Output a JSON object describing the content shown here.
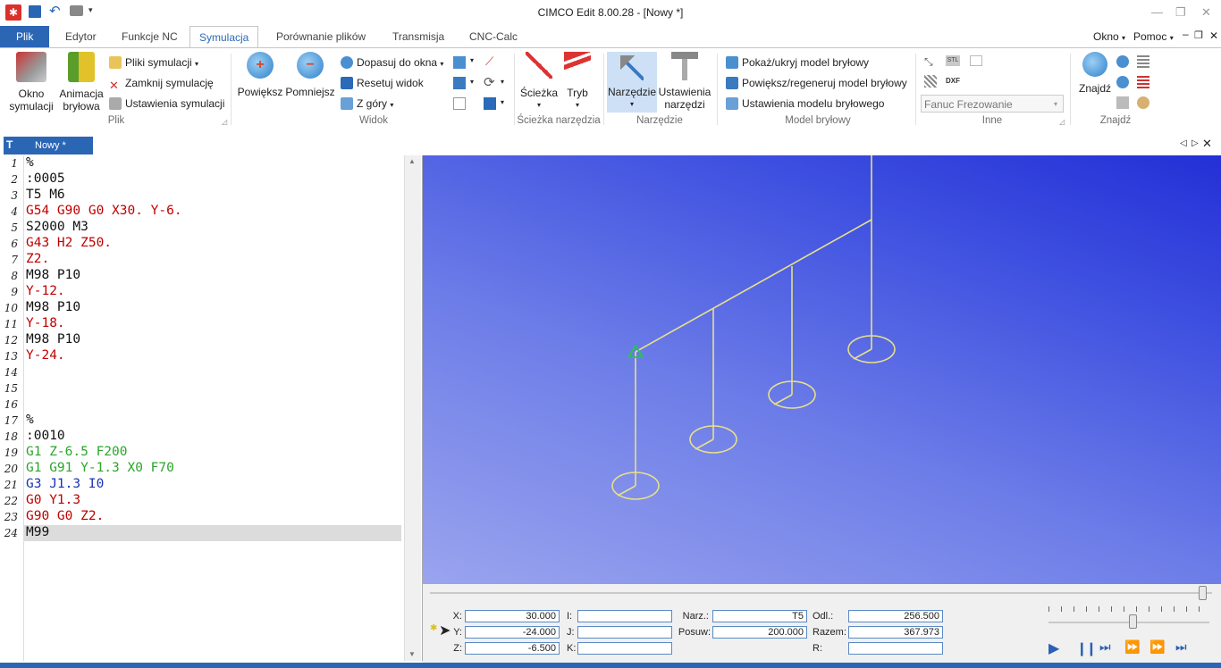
{
  "window": {
    "title": "CIMCO Edit 8.00.28 - [Nowy *]"
  },
  "menu": {
    "tabs": [
      "Plik",
      "Edytor",
      "Funkcje NC",
      "Symulacja",
      "Porównanie plików",
      "Transmisja",
      "CNC-Calc"
    ],
    "right": {
      "okno": "Okno",
      "pomoc": "Pomoc"
    }
  },
  "ribbon": {
    "plik": {
      "okno_symulacji": [
        "Okno",
        "symulacji"
      ],
      "animacja": [
        "Animacja",
        "bryłowa"
      ],
      "pliki_symulacji": "Pliki symulacji",
      "zamknij_symulacje": "Zamknij symulację",
      "ustawienia_symulacji": "Ustawienia symulacji",
      "label": "Plik"
    },
    "widok": {
      "powieksz": "Powiększ",
      "pomniejsz": "Pomniejsz",
      "dopasuj": "Dopasuj do okna",
      "resetuj": "Resetuj widok",
      "z_gory": "Z góry",
      "label": "Widok"
    },
    "sciezka": {
      "sciezka": "Ścieżka",
      "tryb": "Tryb",
      "label": "Ścieżka narzędzia"
    },
    "narzedzie": {
      "narzedzie": "Narzędzie",
      "ustawienia": [
        "Ustawienia",
        "narzędzi"
      ],
      "label": "Narzędzie"
    },
    "model": {
      "pokaz": "Pokaż/ukryj model bryłowy",
      "powieksz": "Powiększ/regeneruj model bryłowy",
      "ustawienia": "Ustawienia modelu bryłowego",
      "label": "Model bryłowy"
    },
    "inne": {
      "dxf": "DXF",
      "stl": "STL",
      "machine_select": "Fanuc Frezowanie",
      "label": "Inne"
    },
    "znajdz": {
      "znajdz": "Znajdź",
      "label": "Znajdź"
    }
  },
  "document": {
    "tab": "Nowy *"
  },
  "editor": {
    "lines": [
      {
        "n": "1",
        "text": "%",
        "color": "#111"
      },
      {
        "n": "2",
        "text": ":0005",
        "color": "#111"
      },
      {
        "n": "3",
        "text": "T5 M6",
        "color": "#111"
      },
      {
        "n": "4",
        "text": "G54 G90 G0 X30. Y-6.",
        "color": "#c00000"
      },
      {
        "n": "5",
        "text": "S2000 M3",
        "color": "#111"
      },
      {
        "n": "6",
        "text": "G43 H2 Z50.",
        "color": "#c00000"
      },
      {
        "n": "7",
        "text": "Z2.",
        "color": "#c00000"
      },
      {
        "n": "8",
        "text": "M98 P10",
        "color": "#111"
      },
      {
        "n": "9",
        "text": "Y-12.",
        "color": "#c00000"
      },
      {
        "n": "10",
        "text": "M98 P10",
        "color": "#111"
      },
      {
        "n": "11",
        "text": "Y-18.",
        "color": "#c00000"
      },
      {
        "n": "12",
        "text": "M98 P10",
        "color": "#111"
      },
      {
        "n": "13",
        "text": "Y-24.",
        "color": "#c00000"
      },
      {
        "n": "14",
        "text": "",
        "color": "#111"
      },
      {
        "n": "15",
        "text": "",
        "color": "#111"
      },
      {
        "n": "16",
        "text": "",
        "color": "#111"
      },
      {
        "n": "17",
        "text": "%",
        "color": "#111"
      },
      {
        "n": "18",
        "text": ":0010",
        "color": "#111"
      },
      {
        "n": "19",
        "text": "G1 Z-6.5 F200",
        "color": "#2aa52a"
      },
      {
        "n": "20",
        "text": "G1 G91 Y-1.3 X0 F70",
        "color": "#2aa52a"
      },
      {
        "n": "21",
        "text": "G3 J1.3 I0",
        "color": "#1a32b8"
      },
      {
        "n": "22",
        "text": "G0 Y1.3",
        "color": "#c00000"
      },
      {
        "n": "23",
        "text": "G90 G0 Z2.",
        "color": "#c00000"
      },
      {
        "n": "24",
        "text": "M99",
        "color": "#111"
      }
    ],
    "current_line": 24
  },
  "simulation": {
    "fields": {
      "x_label": "X:",
      "x": "30.000",
      "y_label": "Y:",
      "y": "-24.000",
      "z_label": "Z:",
      "z": "-6.500",
      "i_label": "I:",
      "i": "",
      "j_label": "J:",
      "j": "",
      "k_label": "K:",
      "k": "",
      "narz_label": "Narz.:",
      "narz": "T5",
      "posuw_label": "Posuw:",
      "posuw": "200.000",
      "odl_label": "Odl.:",
      "odl": "256.500",
      "razem_label": "Razem:",
      "razem": "367.973",
      "r_label": "R:",
      "r": ""
    },
    "timeline_progress": 0.987,
    "speed_level": 0.52
  },
  "colors": {
    "accent": "#2b66b5",
    "toolpath": "#e6e08a",
    "tool_marker": "#22c84a"
  }
}
